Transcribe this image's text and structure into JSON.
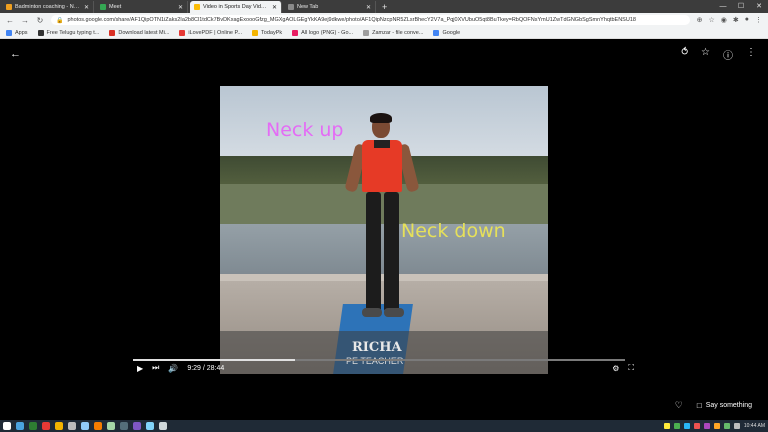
{
  "browser": {
    "tabs": [
      {
        "title": "Badminton coaching - National ...",
        "favicon_color": "#f0a020",
        "active": false
      },
      {
        "title": "Meet",
        "favicon_color": "#34a853",
        "active": false
      },
      {
        "title": "Video in Sports Day Video NEW ...",
        "favicon_color": "#fbbc04",
        "active": true
      },
      {
        "title": "New Tab",
        "favicon_color": "#8a8a8a",
        "active": false
      }
    ],
    "new_tab_symbol": "+",
    "url": "photos.google.com/share/AF1QipOTN1iZaks2Ia2b8Cl1tdCk7BvDKxagExoooGfzg_MGXgAOLGEgYkKA9ej9dkwe/photo/AF1QipNzcpNR5ZLsrBhecY2V7a_Pqj0XVUbuO5qt8BuTkey=RbQOFNsYmU1ZwTdGNGbSgSmnYhqtbENSU18",
    "bookmarks": [
      {
        "label": "Apps",
        "color": "#4285f4"
      },
      {
        "label": "Free Telugu typing t...",
        "color": "#333333"
      },
      {
        "label": "Download latest Mi...",
        "color": "#d93025"
      },
      {
        "label": "iLovePDF | Online P...",
        "color": "#e53935"
      },
      {
        "label": "TodayPk",
        "color": "#f4b400"
      },
      {
        "label": "All logo (PNG) - Go...",
        "color": "#e91e63"
      },
      {
        "label": "Zamzar - file conve...",
        "color": "#9e9e9e"
      },
      {
        "label": "Google",
        "color": "#4285f4"
      }
    ]
  },
  "viewer": {
    "overlay_top": "Neck up",
    "overlay_bottom": "Neck down",
    "lower_third_name": "RICHA",
    "lower_third_role": "PE TEACHER",
    "time_display": "9:29 / 28:44",
    "progress_fraction": 0.33,
    "say_something": "Say something"
  },
  "taskbar": {
    "icon_colors": [
      "#ffffff",
      "#4aa3df",
      "#2e7d32",
      "#e53935",
      "#f4b400",
      "#bdbdbd",
      "#90caf9",
      "#f57c00",
      "#a5d6a7",
      "#546e7a",
      "#7e57c2",
      "#81d4fa",
      "#cfd8dc"
    ],
    "clock": "10:44 AM",
    "tray_colors": [
      "#ffeb3b",
      "#4caf50",
      "#29b6f6",
      "#ef5350",
      "#ab47bc",
      "#ffa726",
      "#66bb6a",
      "#bdbdbd"
    ]
  }
}
